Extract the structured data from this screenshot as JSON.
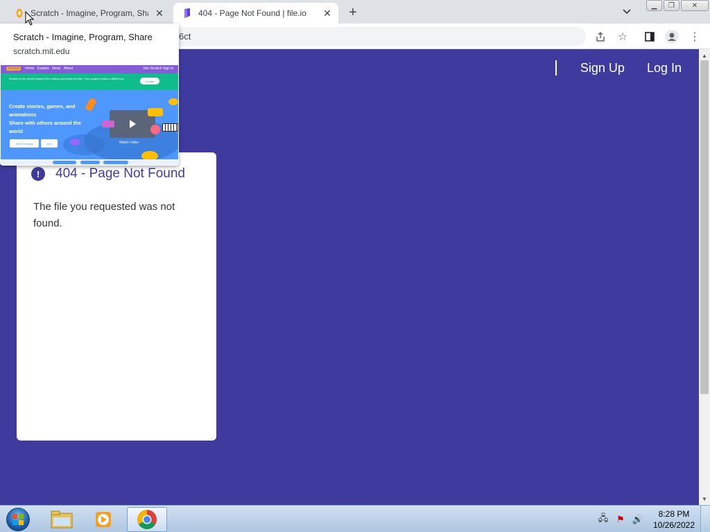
{
  "tabs": [
    {
      "title": "Scratch - Imagine, Program, Share",
      "favicon": "scratch-cat-icon",
      "active": false
    },
    {
      "title": "404 - Page Not Found | file.io",
      "favicon": "file-io-icon",
      "active": true
    }
  ],
  "omnibox": {
    "text": "6ct"
  },
  "hovercard": {
    "title": "Scratch - Imagine, Program, Share",
    "url": "scratch.mit.edu",
    "preview": {
      "nav_items": [
        "Home",
        "Explore",
        "Ideas",
        "About"
      ],
      "nav_right": [
        "Join Scratch",
        "Sign in"
      ],
      "banner": "Scratch is the world's largest free coding community for kids. Your support makes a difference.",
      "donate": "Donate",
      "hero_line1": "Create stories, games, and animations",
      "hero_line2": "Share with others around the world",
      "start_btn": "Start Creating",
      "join_btn": "Join",
      "watch": "Watch Video"
    }
  },
  "page": {
    "nav": {
      "signup": "Sign Up",
      "login": "Log In"
    },
    "error": {
      "heading": "404 - Page Not Found",
      "message": "The file you requested was not found."
    }
  },
  "colors": {
    "page_bg": "#3f3b9e",
    "card_bg": "#ffffff",
    "heading": "#3f3b9e"
  },
  "taskbar": {
    "time": "8:28 PM",
    "date": "10/26/2022",
    "items": [
      "explorer-icon",
      "media-player-icon",
      "chrome-icon"
    ]
  }
}
